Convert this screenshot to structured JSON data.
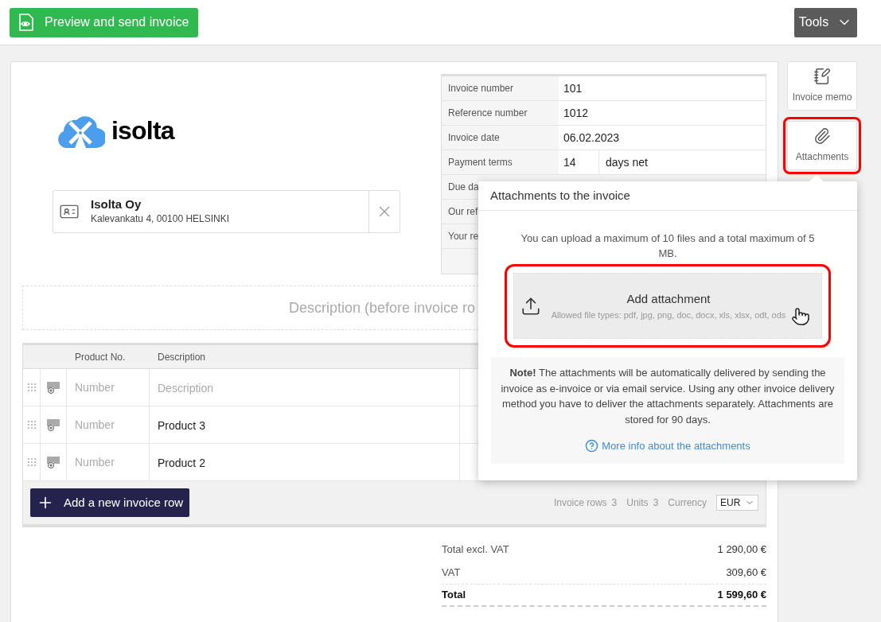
{
  "toolbar": {
    "preview_button": "Preview and send invoice",
    "tools_button": "Tools"
  },
  "logo": {
    "text": "isolta"
  },
  "customer": {
    "name": "Isolta Oy",
    "address": "Kalevankatu 4, 00100 HELSINKI"
  },
  "details": [
    {
      "label": "Invoice number",
      "value": "101"
    },
    {
      "label": "Reference number",
      "value": "1012"
    },
    {
      "label": "Invoice date",
      "value": "06.02.2023"
    },
    {
      "label": "Payment terms",
      "value": "14",
      "unit": "days net"
    },
    {
      "label": "Due da"
    },
    {
      "label": "Our ref"
    },
    {
      "label": "Your re"
    }
  ],
  "description_placeholder": "Description (before invoice ro",
  "table": {
    "columns": [
      "Product No.",
      "Description"
    ],
    "rows": [
      {
        "product_no": {
          "placeholder": "Number"
        },
        "description": {
          "placeholder": "Description"
        }
      },
      {
        "product_no": {
          "placeholder": "Number"
        },
        "description": {
          "value": "Product 3"
        }
      },
      {
        "product_no": {
          "placeholder": "Number"
        },
        "description": {
          "value": "Product 2"
        }
      }
    ]
  },
  "table_footer": {
    "add_button": "Add a new invoice row",
    "stats": [
      {
        "label": "Invoice rows",
        "value": "3"
      },
      {
        "label": "Units",
        "value": "3"
      }
    ],
    "currency": {
      "label": "Currency",
      "value": "EUR"
    }
  },
  "totals": [
    {
      "label": "Total excl. VAT",
      "value": "1 290,00 €",
      "bold": false
    },
    {
      "label": "VAT",
      "value": "309,60 €",
      "bold": false
    },
    {
      "label": "Total",
      "value": "1 599,60 €",
      "bold": true
    }
  ],
  "side_buttons": [
    {
      "label": "Invoice memo",
      "kind": "memo",
      "highlighted": false
    },
    {
      "label": "Attachments",
      "kind": "attachment",
      "highlighted": true
    }
  ],
  "popup": {
    "title": "Attachments to the invoice",
    "limit_text": "You can upload a maximum of 10 files and a total maximum of 5 MB.",
    "add_attachment": {
      "title": "Add attachment",
      "subtitle": "Allowed file types: pdf, jpg, png, doc, docx, xls, xlsx, odt, ods",
      "highlighted": true
    },
    "note": "**Note!** The attachments will be automatically delivered by sending the invoice as e-invoice or via email service. Using any other invoice delivery method you have to deliver the attachments separately. Attachments are stored for 90 days.",
    "link": "More info about the attachments"
  }
}
